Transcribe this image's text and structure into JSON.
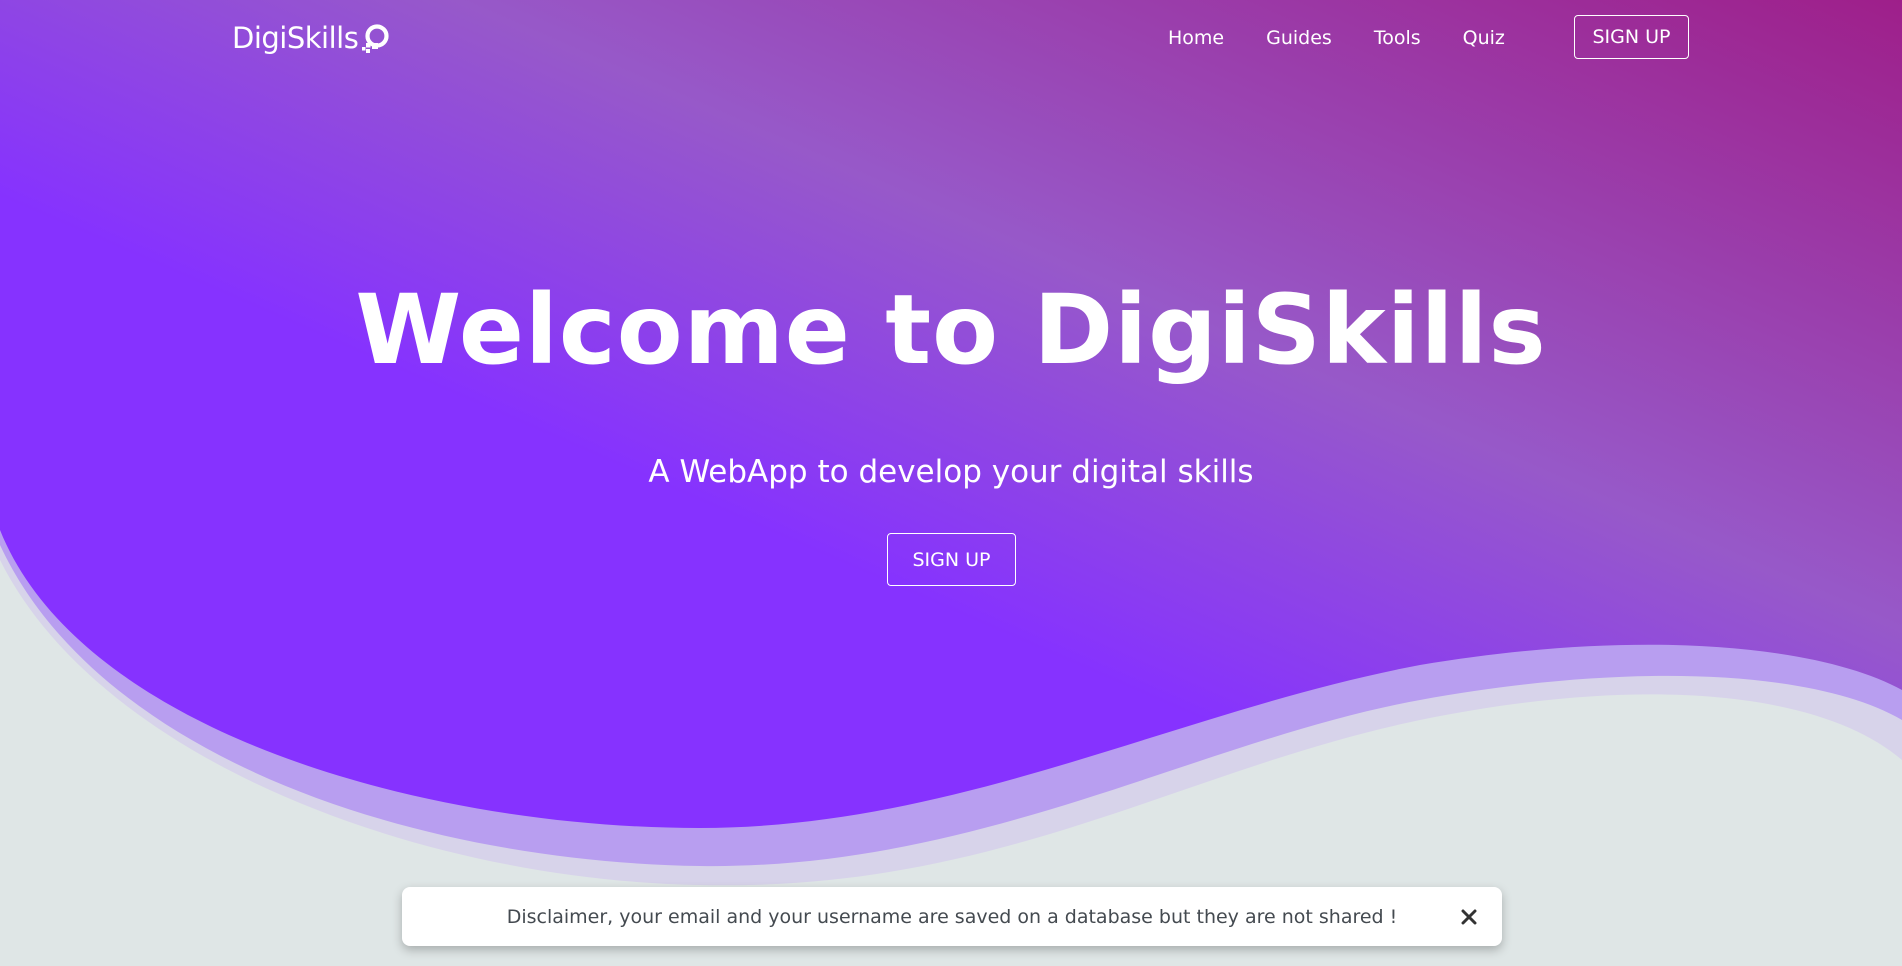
{
  "navbar": {
    "brand": "DigiSkills",
    "brand_icon": "digital-ocean-like-logo-icon",
    "links": [
      {
        "label": "Home"
      },
      {
        "label": "Guides"
      },
      {
        "label": "Tools"
      },
      {
        "label": "Quiz"
      }
    ],
    "signup_label": "SIGN UP"
  },
  "hero": {
    "title": "Welcome to DigiSkills",
    "subtitle": "A WebApp to develop your digital skills",
    "signup_label": "SIGN UP"
  },
  "disclaimer": {
    "text": "Disclaimer, your email and your username are saved on a database but they are not shared !",
    "close_icon": "close-icon"
  },
  "colors": {
    "hero_gradient_start": "#8632ff",
    "hero_gradient_mid": "#9759c9",
    "hero_gradient_end": "#9e1f8a",
    "wave_light": "#b89ef0",
    "wave_lighter": "#d7d3ea",
    "page_background": "#dfe6e6",
    "text_light": "#ffffff",
    "disclaimer_text": "#444a50"
  }
}
